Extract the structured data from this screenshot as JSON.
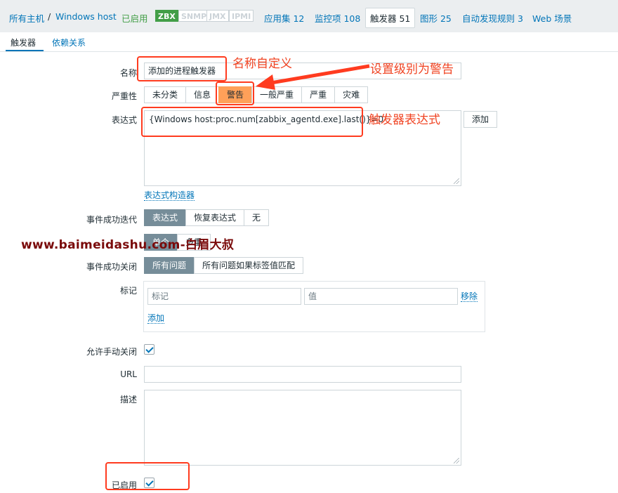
{
  "breadcrumb": {
    "all_hosts": "所有主机",
    "separator": "/",
    "host": "Windows host",
    "status": "已启用"
  },
  "availability": [
    "ZBX",
    "SNMP",
    "JMX",
    "IPMI"
  ],
  "nav": {
    "applications": "应用集 12",
    "items": "监控项 108",
    "triggers": "触发器 51",
    "graphs": "图形 25",
    "discovery": "自动发现规则 3",
    "web": "Web 场景"
  },
  "tabs": {
    "trigger": "触发器",
    "dependencies": "依赖关系"
  },
  "form": {
    "name_label": "名称",
    "name_value": "添加的进程触发器",
    "severity_label": "严重性",
    "severity_options": [
      "未分类",
      "信息",
      "警告",
      "一般严重",
      "严重",
      "灾难"
    ],
    "severity_selected": "警告",
    "expression_label": "表达式",
    "expression_value": "{Windows host:proc.num[zabbix_agentd.exe].last()}=0",
    "add_button": "添加",
    "expression_constructor": "表达式构造器",
    "ok_event_label": "事件成功迭代",
    "ok_event_options": [
      "表达式",
      "恢复表达式",
      "无"
    ],
    "problem_mode_options": [
      "单个",
      "多重"
    ],
    "ok_close_label": "事件成功关闭",
    "ok_close_options": [
      "所有问题",
      "所有问题如果标签值匹配"
    ],
    "tags_label": "标记",
    "tag_placeholder": "标记",
    "value_placeholder": "值",
    "remove_link": "移除",
    "add_tag_link": "添加",
    "manual_close_label": "允许手动关闭",
    "url_label": "URL",
    "description_label": "描述",
    "enabled_label": "已启用"
  },
  "annotations": {
    "name_custom": "名称自定义",
    "set_severity": "设置级别为警告",
    "expression": "触发器表达式",
    "watermark": "www.baimeidashu.com-白眉大叔"
  },
  "colors": {
    "accent": "#0275b8",
    "warning": "#ffa059",
    "callout": "#ff3b1f",
    "enabled": "#429e47"
  }
}
